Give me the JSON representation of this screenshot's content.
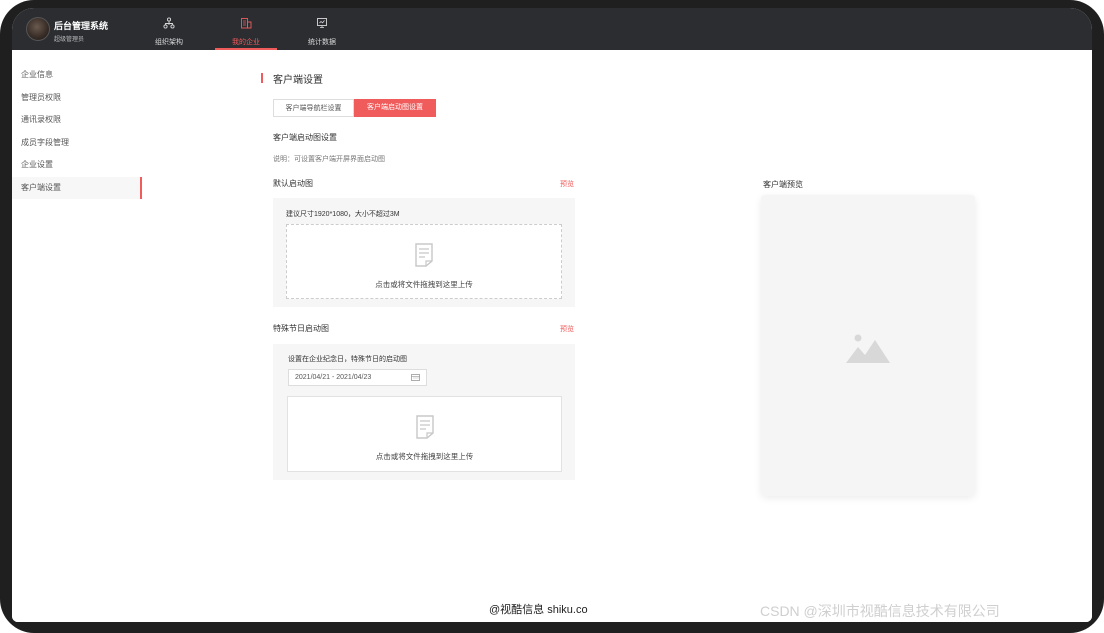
{
  "app": {
    "title": "后台管理系统",
    "role": "超级管理员"
  },
  "nav": [
    {
      "label": "组织架构",
      "icon": "org-structure-icon"
    },
    {
      "label": "我的企业",
      "icon": "enterprise-icon",
      "active": true
    },
    {
      "label": "统计数据",
      "icon": "statistics-icon"
    }
  ],
  "sidebar": {
    "items": [
      {
        "label": "企业信息"
      },
      {
        "label": "管理员权限"
      },
      {
        "label": "通讯录权限"
      },
      {
        "label": "成员字段管理"
      },
      {
        "label": "企业设置"
      },
      {
        "label": "客户端设置",
        "active": true
      }
    ]
  },
  "page": {
    "title": "客户端设置",
    "tabs": [
      {
        "label": "客户端导航栏设置"
      },
      {
        "label": "客户端启动图设置",
        "active": true
      }
    ],
    "section_title": "客户端启动图设置",
    "description": "说明：可设置客户端开屏界面启动图",
    "default_launch": {
      "label": "默认启动图",
      "preview_link": "预览",
      "size_hint": "建议尺寸1920*1080，大小不超过3M",
      "upload_hint": "点击或将文件拖拽到这里上传"
    },
    "holiday_launch": {
      "label": "特殊节日启动图",
      "preview_link": "预览",
      "hint": "设置在企业纪念日，特殊节日的启动图",
      "date_range": "2021/04/21  -  2021/04/23",
      "upload_hint": "点击或将文件拖拽到这里上传"
    },
    "preview": {
      "label": "客户端预览"
    }
  },
  "watermarks": {
    "center": "@视酷信息 shiku.co",
    "right": "CSDN @深圳市视酷信息技术有限公司"
  },
  "colors": {
    "accent": "#f05b5b",
    "topbar": "#2b2d31"
  }
}
